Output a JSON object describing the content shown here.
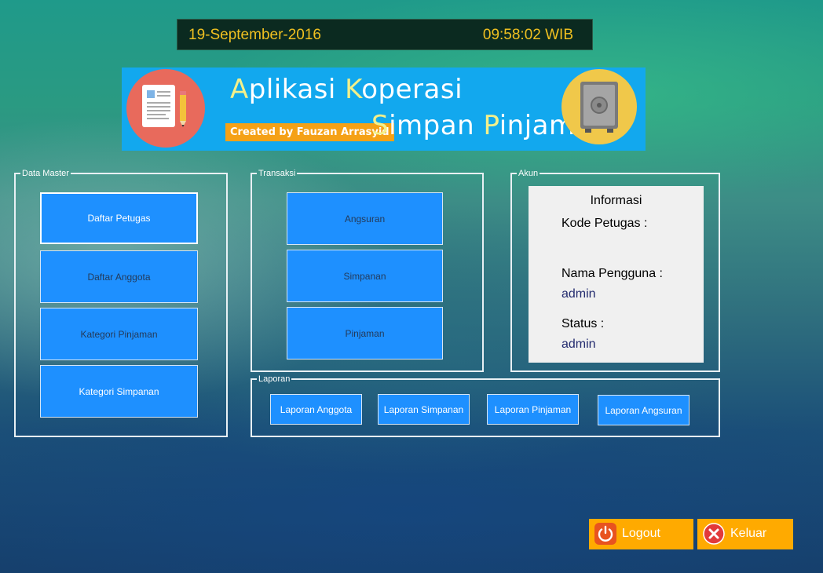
{
  "header": {
    "date": "19-September-2016",
    "time": "09:58:02 WIB"
  },
  "banner": {
    "title_line1_parts": [
      "A",
      "plikasi ",
      "K",
      "operasi"
    ],
    "title_line2_parts": [
      "S",
      "impan ",
      "P",
      "injam"
    ],
    "credit": "Created by Fauzan Arrasyid"
  },
  "data_master": {
    "legend": "Data Master",
    "buttons": [
      "Daftar Petugas",
      "Daftar Anggota",
      "Kategori Pinjaman",
      "Kategori Simpanan"
    ]
  },
  "transaksi": {
    "legend": "Transaksi",
    "buttons": [
      "Angsuran",
      "Simpanan",
      "Pinjaman"
    ]
  },
  "akun": {
    "legend": "Akun",
    "info_title": "Informasi",
    "kode_label": "Kode Petugas :",
    "kode_value": "",
    "nama_label": "Nama Pengguna :",
    "nama_value": "admin",
    "status_label": "Status :",
    "status_value": "admin"
  },
  "laporan": {
    "legend": "Laporan",
    "buttons": [
      "Laporan Anggota",
      "Laporan Simpanan",
      "Laporan Pinjaman",
      "Laporan Angsuran"
    ]
  },
  "actions": {
    "logout_label": "Logout",
    "logout_icon": "power-icon",
    "exit_label": "Keluar",
    "exit_icon": "close-icon"
  },
  "colors": {
    "button_blue": "#1e90ff",
    "clock_text": "#f0c020",
    "action_orange": "#ffaa00",
    "banner_blue": "#12a8ee"
  }
}
